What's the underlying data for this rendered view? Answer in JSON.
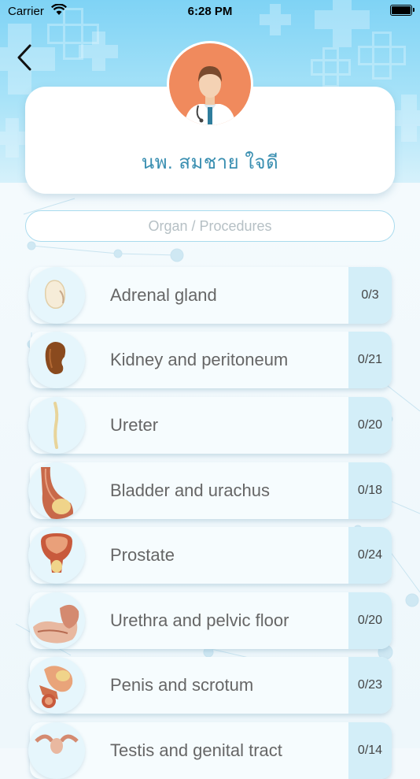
{
  "status_bar": {
    "carrier": "Carrier",
    "time": "6:28 PM"
  },
  "profile": {
    "name": "นพ. สมชาย ใจดี"
  },
  "search": {
    "placeholder": "Organ / Procedures"
  },
  "organs": [
    {
      "label": "Adrenal gland",
      "count": "0/3",
      "icon": "adrenal-gland-icon"
    },
    {
      "label": "Kidney and peritoneum",
      "count": "0/21",
      "icon": "kidney-icon"
    },
    {
      "label": "Ureter",
      "count": "0/20",
      "icon": "ureter-icon"
    },
    {
      "label": "Bladder and urachus",
      "count": "0/18",
      "icon": "bladder-icon"
    },
    {
      "label": "Prostate",
      "count": "0/24",
      "icon": "prostate-icon"
    },
    {
      "label": "Urethra and pelvic floor",
      "count": "0/20",
      "icon": "pelvic-floor-icon"
    },
    {
      "label": "Penis and scrotum",
      "count": "0/23",
      "icon": "penis-scrotum-icon"
    },
    {
      "label": "Testis and genital tract",
      "count": "0/14",
      "icon": "genital-tract-icon"
    }
  ],
  "colors": {
    "accent": "#3a8fb1",
    "header": "#7fd3f5",
    "count_bg": "#d3eef8",
    "avatar": "#f08a5d"
  }
}
